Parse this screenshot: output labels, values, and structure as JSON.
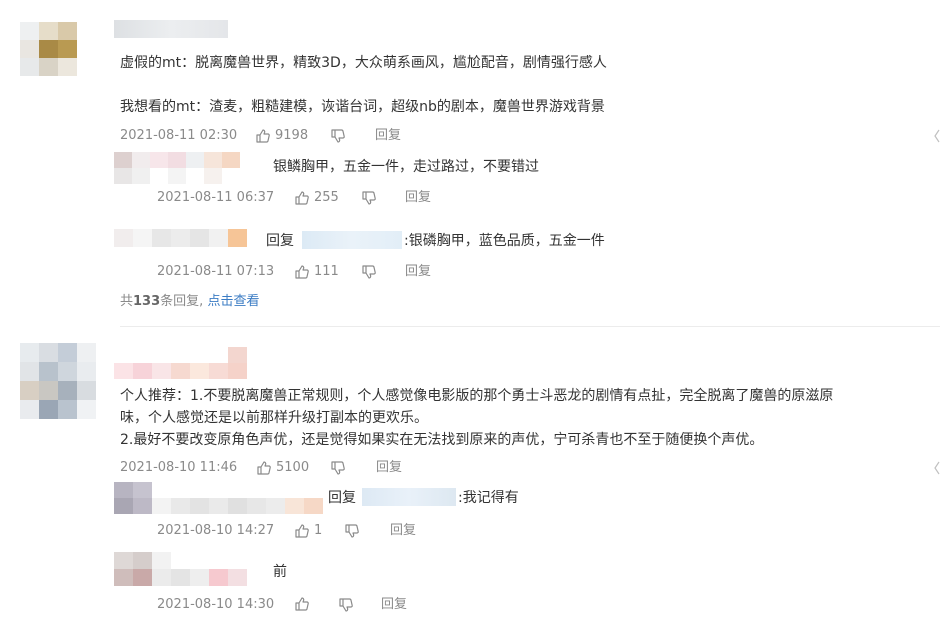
{
  "comments": [
    {
      "body_lines": [
        "虚假的mt：脱离魔兽世界，精致3D，大众萌系画风，尴尬配音，剧情强行感人",
        "",
        "我想看的mt：渣麦，粗糙建模，诙谐台词，超级nb的剧本，魔兽世界游戏背景"
      ],
      "time": "2021-08-11 02:30",
      "likes": "9198",
      "reply_label": "回复",
      "replies": [
        {
          "text": "银鳞胸甲，五金一件，走过路过，不要错过",
          "reply_to": "",
          "time": "2021-08-11 06:37",
          "likes": "255",
          "reply_label": "回复"
        },
        {
          "text": ":银磷胸甲，蓝色品质，五金一件",
          "reply_to": "回复",
          "time": "2021-08-11 07:13",
          "likes": "111",
          "reply_label": "回复"
        }
      ],
      "more": {
        "prefix": "共",
        "count": "133",
        "suffix": "条回复,",
        "link": "点击查看"
      }
    },
    {
      "body_lines": [
        "个人推荐：1.不要脱离魔兽正常规则，个人感觉像电影版的那个勇士斗恶龙的剧情有点扯，完全脱离了魔兽的原滋原",
        "味，个人感觉还是以前那样升级打副本的更欢乐。",
        "2.最好不要改变原角色声优，还是觉得如果实在无法找到原来的声优，宁可杀青也不至于随便换个声优。"
      ],
      "time": "2021-08-10 11:46",
      "likes": "5100",
      "reply_label": "回复",
      "replies": [
        {
          "text": ":我记得有",
          "reply_to": "回复",
          "time": "2021-08-10 14:27",
          "likes": "1",
          "reply_label": "回复"
        },
        {
          "text": "前",
          "reply_to": "",
          "time": "2021-08-10 14:30",
          "likes": "",
          "reply_label": "回复"
        }
      ]
    }
  ],
  "icons": {
    "like": "thumbs-up-icon",
    "dislike": "thumbs-down-icon"
  },
  "colors": {
    "link": "#3b7cc4",
    "meta": "#8a8a8a",
    "text": "#333333"
  }
}
